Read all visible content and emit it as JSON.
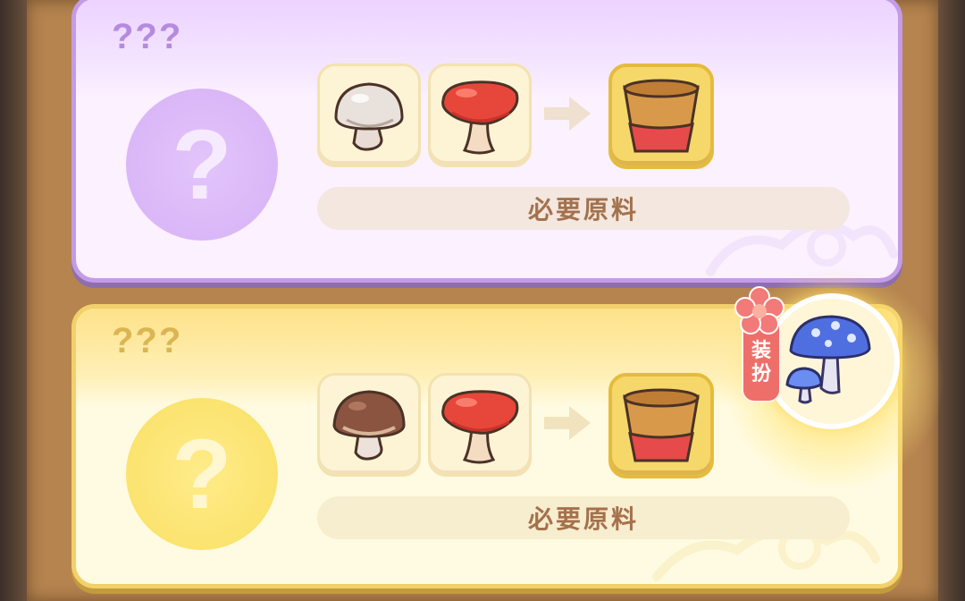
{
  "recipes": [
    {
      "title": "???",
      "unknown_symbol": "?",
      "ingredients": [
        "white-mushroom-icon",
        "red-cap-mushroom-icon"
      ],
      "result": "flower-pot-icon",
      "requirement_label": "必要原料",
      "theme": {
        "border": "#c49be6",
        "title": "#b58be0"
      }
    },
    {
      "title": "???",
      "unknown_symbol": "?",
      "ingredients": [
        "brown-mushroom-icon",
        "red-cap-mushroom-icon"
      ],
      "result": "flower-pot-icon",
      "requirement_label": "必要原料",
      "theme": {
        "border": "#f2d06a",
        "title": "#dcb553"
      },
      "reward": {
        "tag_label_line1": "装",
        "tag_label_line2": "扮",
        "icon": "blue-spotted-mushroom-icon"
      }
    }
  ]
}
